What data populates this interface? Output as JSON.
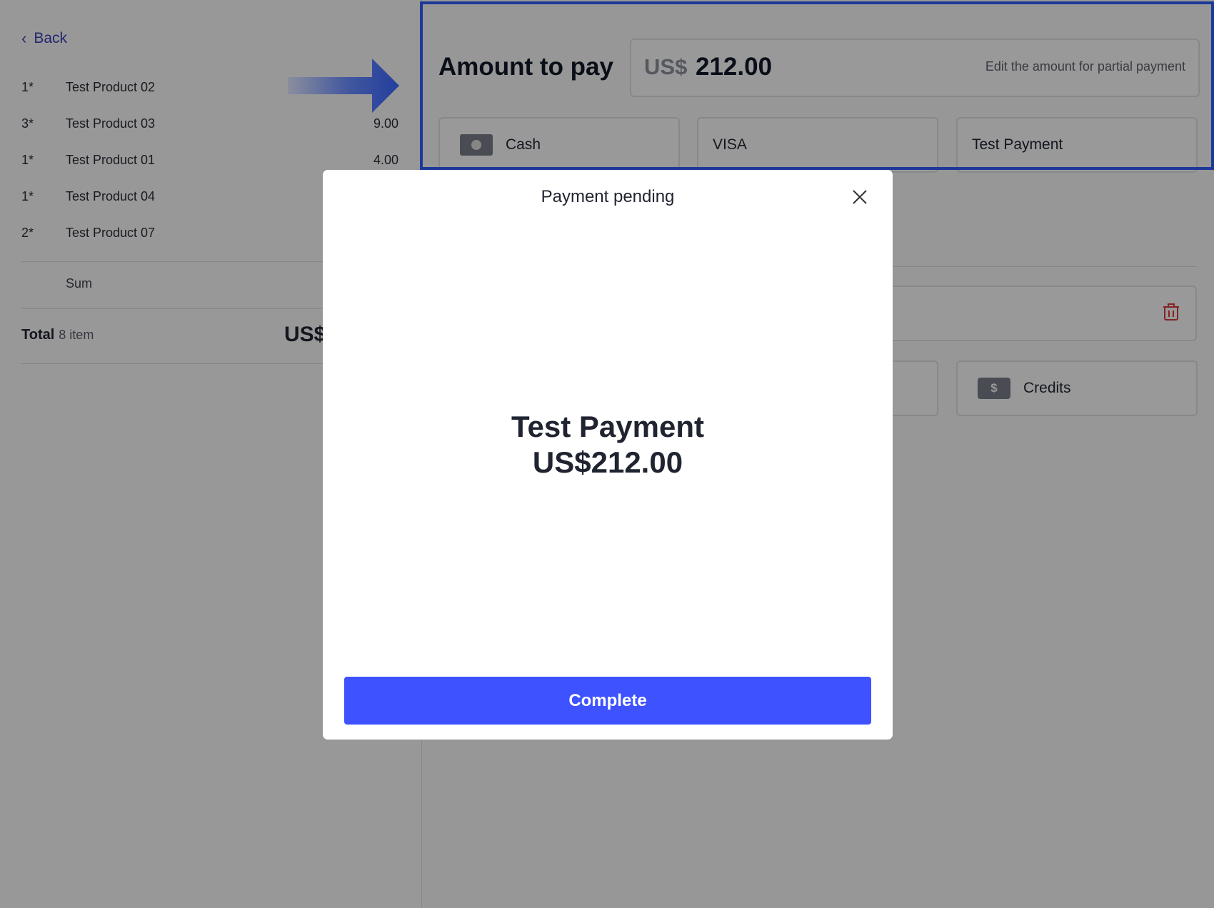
{
  "nav": {
    "back_label": "Back"
  },
  "order": {
    "items": [
      {
        "qty": "1*",
        "name": "Test Product 02",
        "price": ""
      },
      {
        "qty": "3*",
        "name": "Test Product 03",
        "price": "9.00"
      },
      {
        "qty": "1*",
        "name": "Test Product 01",
        "price": "4.00"
      },
      {
        "qty": "1*",
        "name": "Test Product 04",
        "price": ""
      },
      {
        "qty": "2*",
        "name": "Test Product 07",
        "price": ""
      }
    ],
    "sum_label": "Sum",
    "total_label": "Total",
    "total_count": "8 item",
    "total_amount_partial": "US$"
  },
  "payment": {
    "title": "Amount to pay",
    "currency": "US$",
    "amount": "212.00",
    "hint": "Edit the amount for partial payment",
    "methods": [
      {
        "label": "Cash",
        "icon": "cash-icon"
      },
      {
        "label": "VISA"
      },
      {
        "label": "Test Payment"
      }
    ],
    "credits_label": "Credits",
    "credits_icon": "dollar-bill-icon",
    "trash_icon": "trash-icon"
  },
  "annotation": {
    "color": "#2f5df5",
    "icon": "arrow-right-icon"
  },
  "modal": {
    "title": "Payment pending",
    "method": "Test Payment",
    "amount": "US$212.00",
    "complete_label": "Complete",
    "close_icon": "close-icon",
    "button_color": "#3e52ff"
  }
}
